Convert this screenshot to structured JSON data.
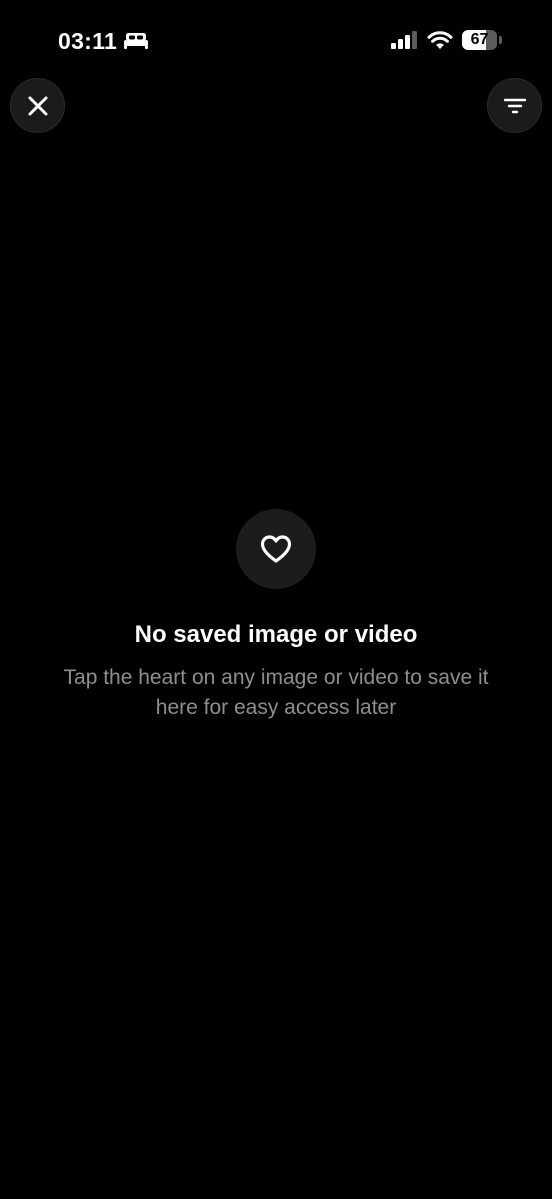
{
  "status_bar": {
    "time": "03:11",
    "battery_level": "67",
    "battery_fraction": 0.67,
    "icons": [
      "sleep-focus-icon",
      "cellular-signal-icon",
      "wifi-icon",
      "battery-icon"
    ]
  },
  "nav": {
    "close_icon": "close-icon",
    "filter_icon": "filter-icon"
  },
  "empty_state": {
    "icon": "heart-outline-icon",
    "title": "No saved image or video",
    "subtitle": "Tap the heart on any image or video to save it here for easy access later"
  },
  "colors": {
    "background": "#000000",
    "button_bg": "#1b1b1b",
    "title_text": "#ffffff",
    "subtitle_text": "#8e8e93"
  }
}
